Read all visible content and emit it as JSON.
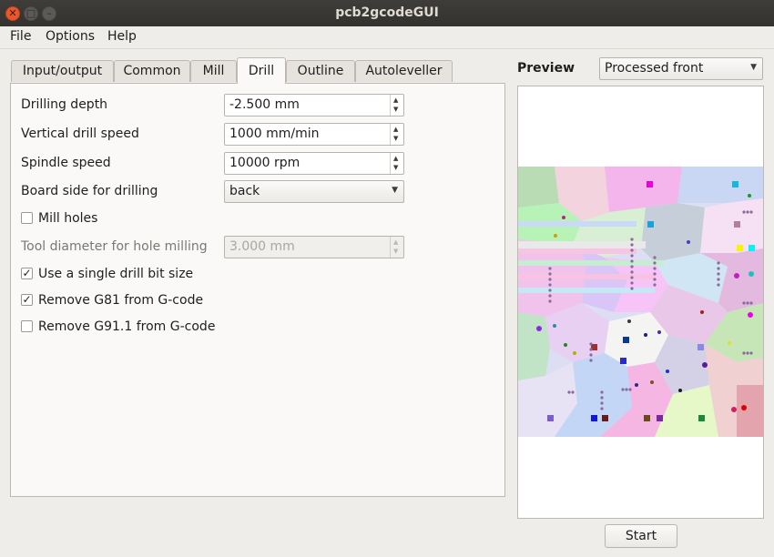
{
  "window": {
    "title": "pcb2gcodeGUI"
  },
  "menu": [
    "File",
    "Options",
    "Help"
  ],
  "tabs": [
    "Input/output",
    "Common",
    "Mill",
    "Drill",
    "Outline",
    "Autoleveller"
  ],
  "active_tab": "Drill",
  "drill": {
    "drilling_depth": {
      "label": "Drilling depth",
      "value": "-2.500 mm"
    },
    "vertical_speed": {
      "label": "Vertical drill speed",
      "value": "1000 mm/min"
    },
    "spindle_speed": {
      "label": "Spindle speed",
      "value": "10000 rpm"
    },
    "board_side": {
      "label": "Board side for drilling",
      "value": "back"
    },
    "mill_holes": {
      "label": "Mill holes",
      "checked": false
    },
    "tool_diameter": {
      "label": "Tool diameter for hole milling",
      "value": "3.000 mm",
      "enabled": false
    },
    "single_bit": {
      "label": "Use a single drill bit size",
      "checked": true
    },
    "remove_g81": {
      "label": "Remove G81 from G-code",
      "checked": true
    },
    "remove_g91": {
      "label": "Remove G91.1 from G-code",
      "checked": false
    }
  },
  "preview": {
    "label": "Preview",
    "mode": "Processed front"
  },
  "start_label": "Start",
  "icons": {
    "close": "close-icon",
    "maximize": "maximize-icon",
    "minimize": "minimize-icon",
    "dropdown": "chevron-down-icon",
    "spin_up": "spin-up-icon",
    "spin_down": "spin-down-icon",
    "check": "check-icon"
  },
  "colors": {
    "titlebar": "#3b3a36",
    "close_button": "#e9572a",
    "window_bg": "#efedea",
    "panel_bg": "#fbf9f7"
  }
}
